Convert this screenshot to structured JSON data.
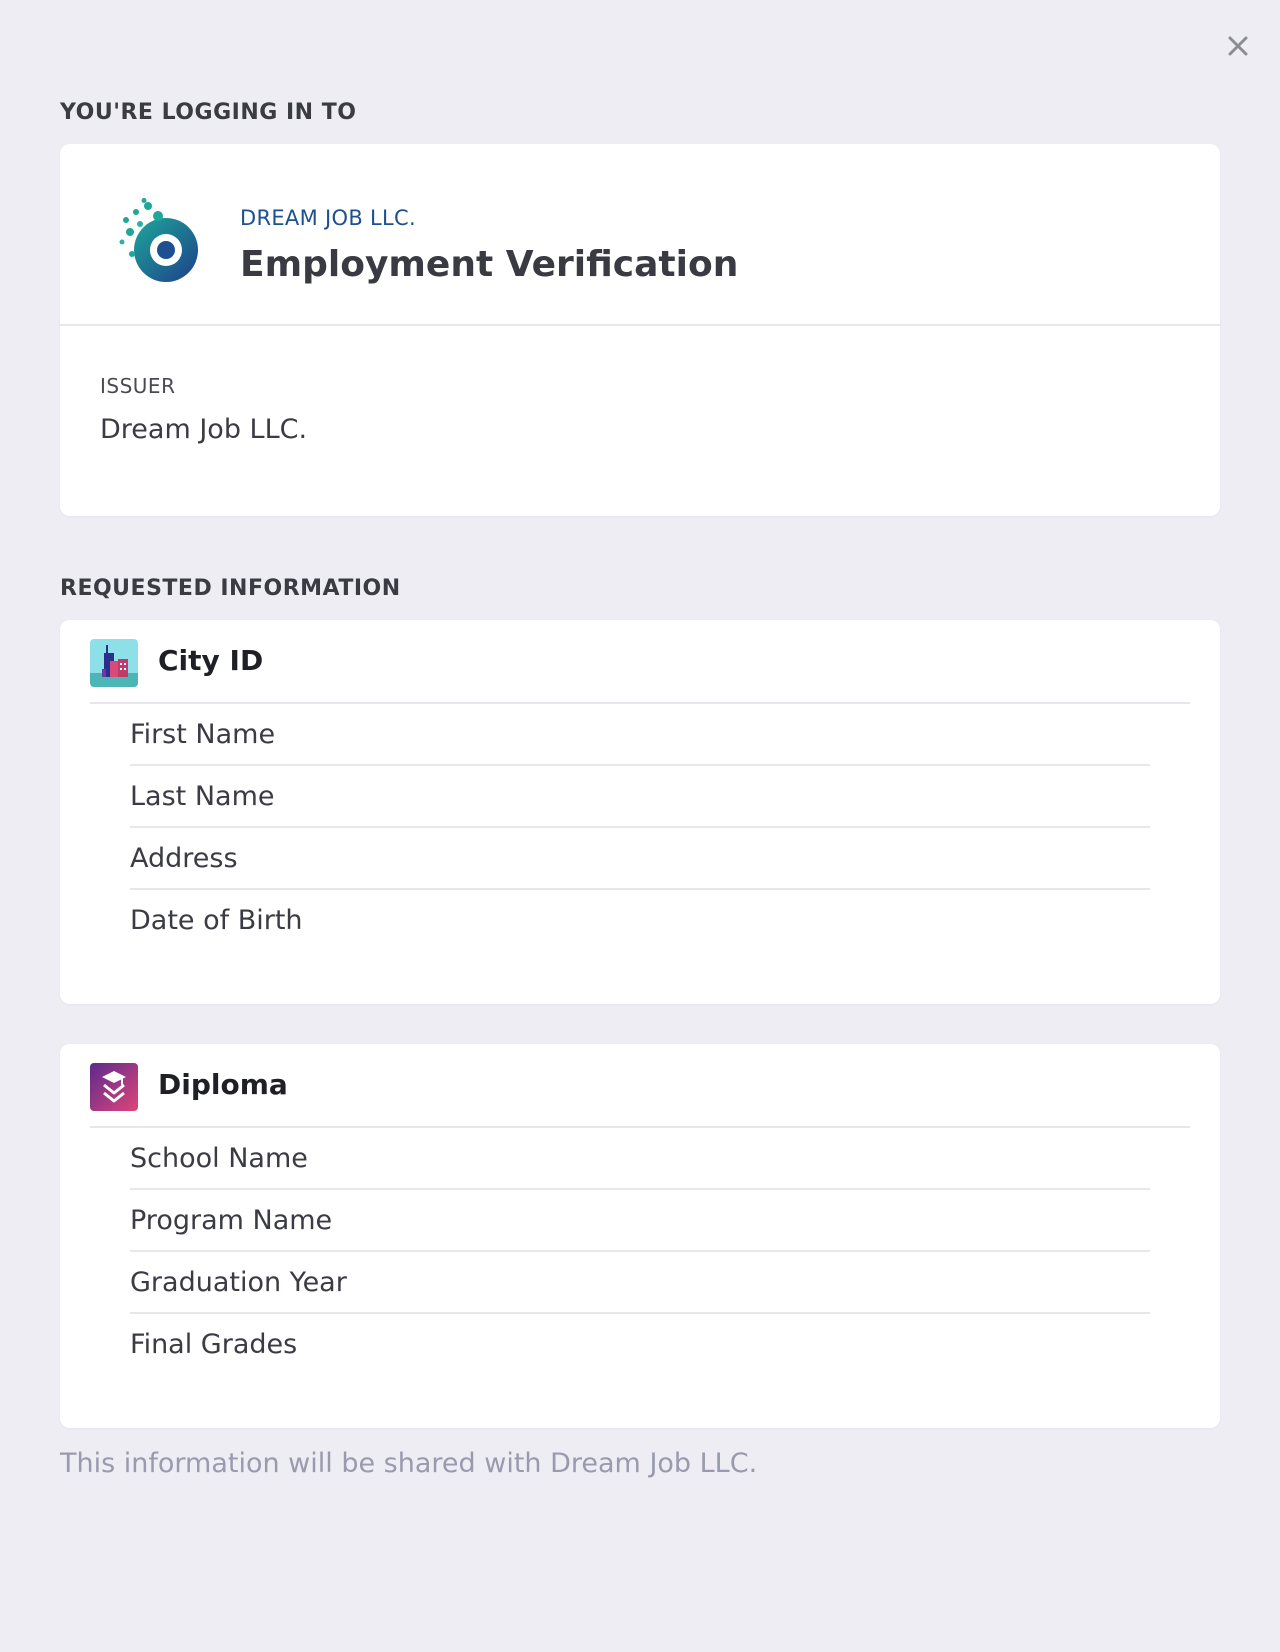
{
  "header": {
    "close_icon": "close-icon"
  },
  "login": {
    "heading": "YOU'RE LOGGING IN TO",
    "org": "DREAM JOB LLC.",
    "title": "Employment Verification",
    "logo_icon": "dream-job-logo",
    "issuer_label": "ISSUER",
    "issuer_value": "Dream Job LLC."
  },
  "requested": {
    "heading": "REQUESTED INFORMATION",
    "credentials": [
      {
        "name": "City ID",
        "icon": "city-id-icon",
        "fields": [
          "First Name",
          "Last Name",
          "Address",
          "Date of Birth"
        ]
      },
      {
        "name": "Diploma",
        "icon": "diploma-icon",
        "fields": [
          "School Name",
          "Program Name",
          "Graduation Year",
          "Final Grades"
        ]
      }
    ]
  },
  "footer": {
    "note": "This information will be shared with Dream Job LLC."
  },
  "colors": {
    "background": "#ededf3",
    "card": "#ffffff",
    "org_blue": "#1d4f91",
    "muted_text": "#9a9aaf"
  }
}
